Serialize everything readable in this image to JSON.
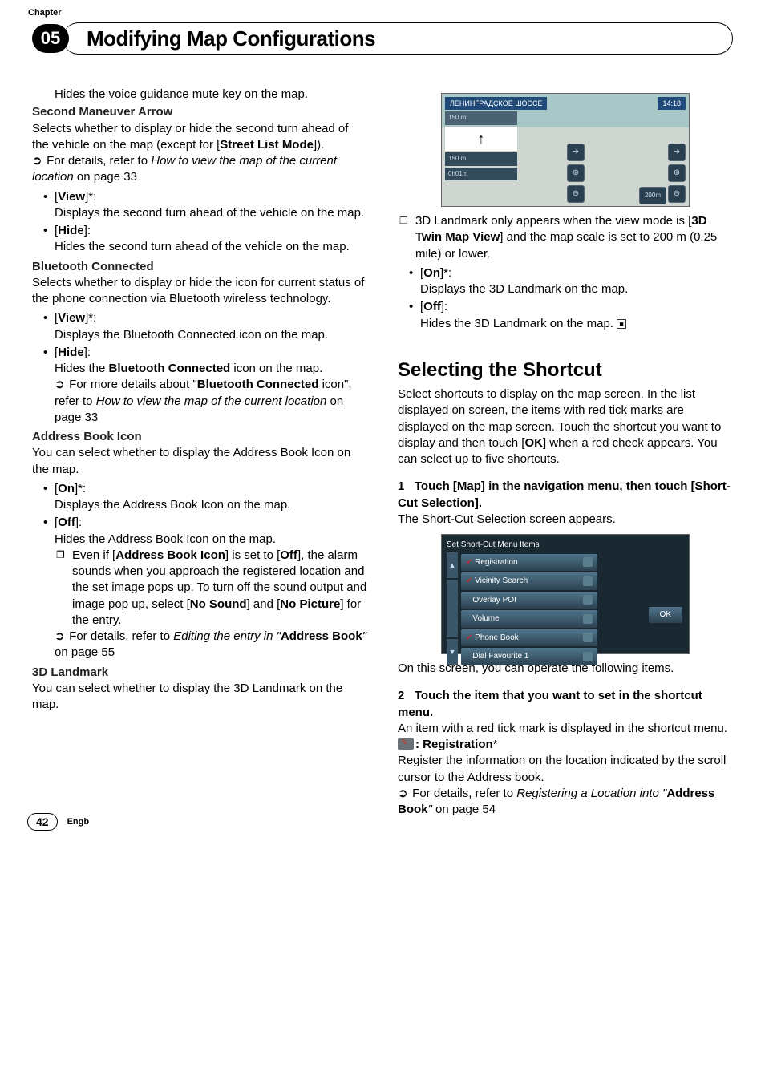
{
  "chapter": {
    "label": "Chapter",
    "number": "05",
    "title": "Modifying Map Configurations"
  },
  "left": {
    "intro": "Hides the voice guidance mute key on the map.",
    "second_maneuver": {
      "label": "Second Maneuver Arrow",
      "desc1": "Selects whether to display or hide the second turn ahead of the vehicle on the map (except for [",
      "desc1_bold": "Street List Mode",
      "desc1_end": "]).",
      "ref_prefix": "For details, refer to ",
      "ref_italic": "How to view the map of the current location",
      "ref_suffix": " on page 33",
      "view_label": "View",
      "view_desc": "Displays the second turn ahead of the vehicle on the map.",
      "hide_label": "Hide",
      "hide_desc": "Hides the second turn ahead of the vehicle on the map."
    },
    "bluetooth": {
      "label": "Bluetooth Connected",
      "desc": "Selects whether to display or hide the icon for current status of the phone connection via Bluetooth wireless technology.",
      "view_label": "View",
      "view_desc": "Displays the Bluetooth Connected icon on the map.",
      "hide_label": "Hide",
      "hide_desc_prefix": "Hides the ",
      "hide_desc_bold": "Bluetooth Connected",
      "hide_desc_suffix": " icon on the map.",
      "more_prefix": "For more details about \"",
      "more_bold": "Bluetooth Connected",
      "more_mid": " icon\", refer to ",
      "more_italic": "How to view the map of the current location",
      "more_suffix": " on page 33"
    },
    "addressbook": {
      "label": "Address Book Icon",
      "desc": "You can select whether to display the Address Book Icon on the map.",
      "on_label": "On",
      "on_desc": "Displays the Address Book Icon on the map.",
      "off_label": "Off",
      "off_desc": "Hides the Address Book Icon on the map.",
      "note_prefix": "Even if [",
      "note_b1": "Address Book Icon",
      "note_mid1": "] is set to [",
      "note_b2": "Off",
      "note_mid2": "], the alarm sounds when you approach the registered location and the set image pops up. To turn off the sound output and image pop up, select [",
      "note_b3": "No Sound",
      "note_mid3": "] and [",
      "note_b4": "No Picture",
      "note_end": "] for the entry.",
      "ref_prefix": "For details, refer to ",
      "ref_italic1": "Editing the entry in \"",
      "ref_bold": "Address Book",
      "ref_italic2": "\"",
      "ref_suffix": " on page 55"
    },
    "landmark": {
      "label": "3D Landmark",
      "desc": "You can select whether to display the 3D Landmark on the map."
    }
  },
  "right": {
    "map_shot": {
      "street": "ЛЕНИНГРАДСКОЕ ШОССЕ",
      "dist1": "150 m",
      "dist2": "150 m",
      "eta": "0h01m",
      "time": "14:18",
      "bottom_scale": "200m"
    },
    "landmark_note_prefix": "3D Landmark only appears when the view mode is [",
    "landmark_note_bold": "3D Twin Map View",
    "landmark_note_suffix": "] and the map scale is set to 200 m (0.25 mile) or lower.",
    "on_label": "On",
    "on_desc": "Displays the 3D Landmark on the map.",
    "off_label": "Off",
    "off_desc": "Hides the 3D Landmark on the map.",
    "shortcut": {
      "heading": "Selecting the Shortcut",
      "intro_p1": "Select shortcuts to display on the map screen. In the list displayed on screen, the items with red tick marks are displayed on the map screen. Touch the shortcut you want to display and then touch [",
      "intro_bold": "OK",
      "intro_p2": "] when a red check appears. You can select up to five shortcuts.",
      "step1_num": "1",
      "step1_label": "Touch [Map] in the navigation menu, then touch [Short-Cut Selection].",
      "step1_desc": "The Short-Cut Selection screen appears.",
      "menu_title": "Set Short-Cut Menu Items",
      "menu_items": [
        "Registration",
        "Vicinity Search",
        "Overlay POI",
        "Volume",
        "Phone Book",
        "Dial Favourite 1"
      ],
      "ok": "OK",
      "after_shot": "On this screen, you can operate the following items.",
      "step2_num": "2",
      "step2_label": "Touch the item that you want to set in the shortcut menu.",
      "step2_desc": "An item with a red tick mark is displayed in the shortcut menu.",
      "reg_label": ": Registration",
      "reg_star": "*",
      "reg_desc": "Register the information on the location indicated by the scroll cursor to the Address book.",
      "ref_prefix": "For details, refer to ",
      "ref_italic1": "Registering a Location into \"",
      "ref_bold": "Address Book",
      "ref_italic2": "\"",
      "ref_suffix": " on page 54"
    }
  },
  "footer": {
    "page": "42",
    "lang": "Engb"
  }
}
